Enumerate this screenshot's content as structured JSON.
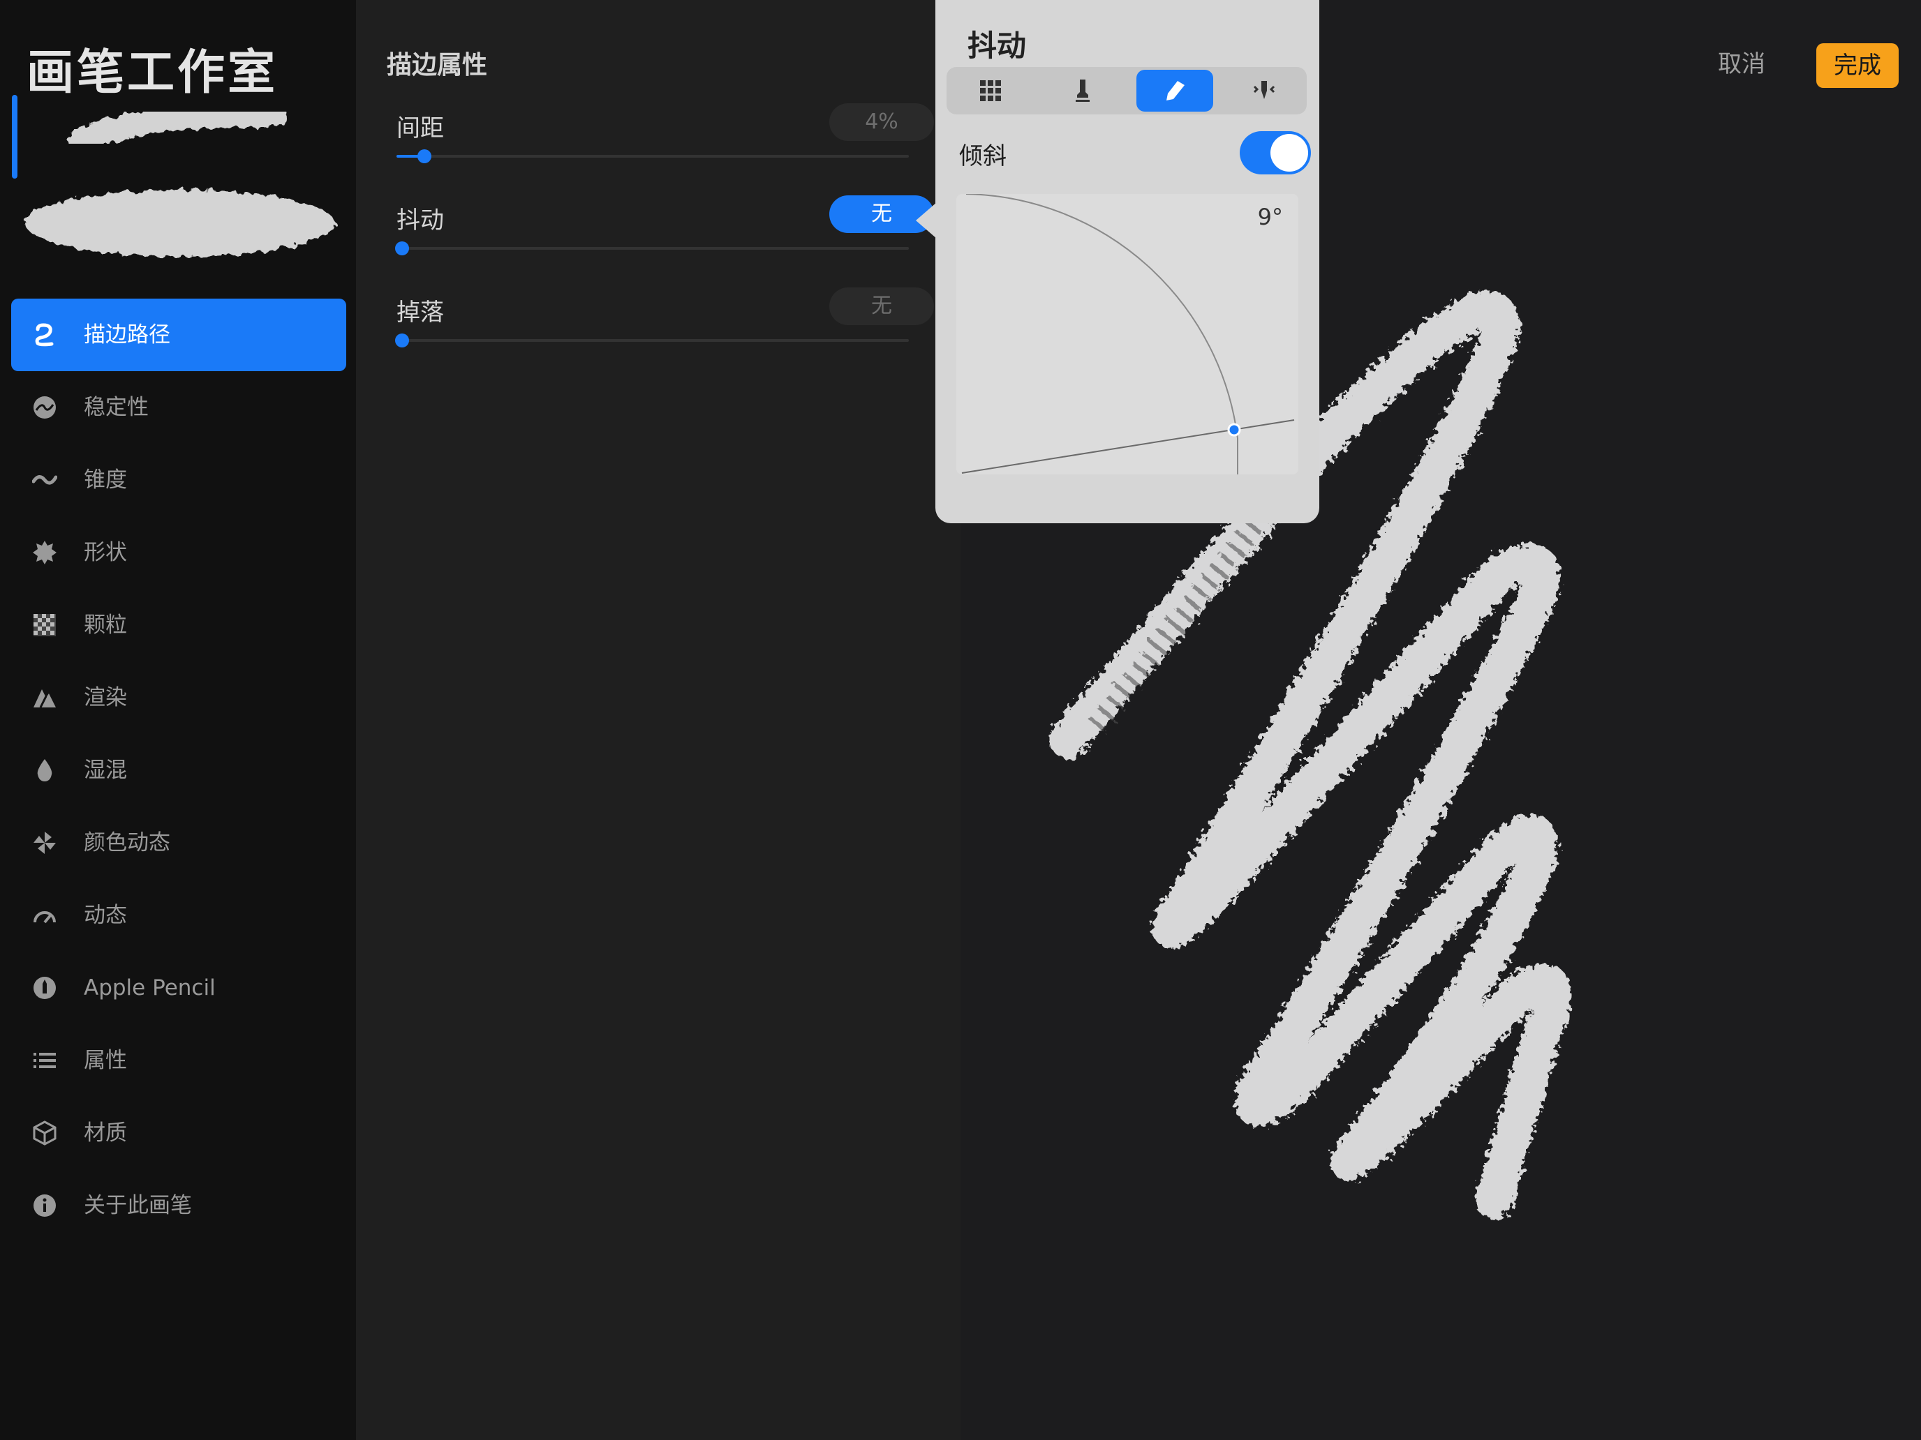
{
  "sidebar": {
    "title": "画笔工作室",
    "items": [
      {
        "label": "描边路径",
        "icon": "stroke-path-icon",
        "selected": true
      },
      {
        "label": "稳定性",
        "icon": "stabilization-icon"
      },
      {
        "label": "锥度",
        "icon": "taper-icon"
      },
      {
        "label": "形状",
        "icon": "shape-icon"
      },
      {
        "label": "颗粒",
        "icon": "grain-icon"
      },
      {
        "label": "渲染",
        "icon": "rendering-icon"
      },
      {
        "label": "湿混",
        "icon": "wet-mix-icon"
      },
      {
        "label": "颜色动态",
        "icon": "color-dynamics-icon"
      },
      {
        "label": "动态",
        "icon": "dynamics-icon"
      },
      {
        "label": "Apple Pencil",
        "icon": "apple-pencil-icon"
      },
      {
        "label": "属性",
        "icon": "properties-icon"
      },
      {
        "label": "材质",
        "icon": "materials-icon"
      },
      {
        "label": "关于此画笔",
        "icon": "info-icon"
      }
    ]
  },
  "props": {
    "title": "描边属性",
    "rows": [
      {
        "label": "间距",
        "value": "4%",
        "level": 0.04,
        "active": false
      },
      {
        "label": "抖动",
        "value": "无",
        "level": 0,
        "active": true
      },
      {
        "label": "掉落",
        "value": "无",
        "level": 0,
        "active": false
      }
    ]
  },
  "toolbar": {
    "cancel_label": "取消",
    "done_label": "完成"
  },
  "popover": {
    "title": "抖动",
    "segments": [
      "grid-icon",
      "stamp-icon",
      "pencil-icon",
      "pressure-icon"
    ],
    "selected_segment": 2,
    "tilt_label": "倾斜",
    "tilt_enabled": true,
    "tilt_angle": "9°"
  },
  "colors": {
    "accent": "#1a7af8",
    "done": "#f7a11a",
    "sidebar": "#111111",
    "popover": "#d6d6d6"
  }
}
